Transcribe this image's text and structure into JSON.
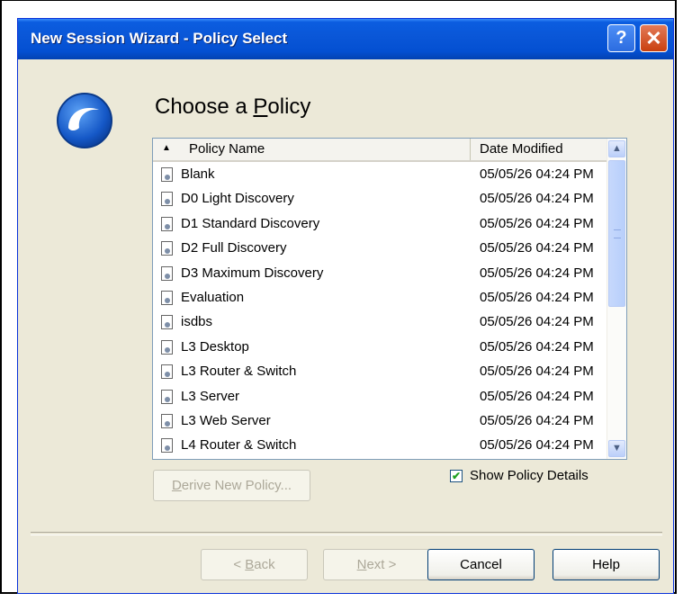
{
  "window": {
    "title": "New Session Wizard - Policy Select",
    "help_glyph": "?",
    "close_glyph": "✕"
  },
  "heading": {
    "prefix": "Choose a ",
    "accel": "P",
    "suffix": "olicy"
  },
  "list": {
    "columns": {
      "name": "Policy Name",
      "date": "Date Modified",
      "sort_glyph": "▲"
    },
    "rows": [
      {
        "name": "Blank",
        "date": "05/05/26 04:24 PM"
      },
      {
        "name": "D0 Light Discovery",
        "date": "05/05/26 04:24 PM"
      },
      {
        "name": "D1 Standard Discovery",
        "date": "05/05/26 04:24 PM"
      },
      {
        "name": "D2 Full Discovery",
        "date": "05/05/26 04:24 PM"
      },
      {
        "name": "D3 Maximum Discovery",
        "date": "05/05/26 04:24 PM"
      },
      {
        "name": "Evaluation",
        "date": "05/05/26 04:24 PM"
      },
      {
        "name": "isdbs",
        "date": "05/05/26 04:24 PM"
      },
      {
        "name": "L3 Desktop",
        "date": "05/05/26 04:24 PM"
      },
      {
        "name": "L3 Router & Switch",
        "date": "05/05/26 04:24 PM"
      },
      {
        "name": "L3 Server",
        "date": "05/05/26 04:24 PM"
      },
      {
        "name": "L3 Web Server",
        "date": "05/05/26 04:24 PM"
      },
      {
        "name": "L4 Router & Switch",
        "date": "05/05/26 04:24 PM"
      }
    ],
    "scroll_up_glyph": "▲",
    "scroll_down_glyph": "▼"
  },
  "derive_button": {
    "accel": "D",
    "rest": "erive New Policy..."
  },
  "show_details": {
    "label": "Show Policy Details",
    "checked": true,
    "check_glyph": "✔"
  },
  "buttons": {
    "back": {
      "prefix": "< ",
      "accel": "B",
      "rest": "ack"
    },
    "next": {
      "accel": "N",
      "rest": "ext >"
    },
    "cancel": "Cancel",
    "help": "Help"
  },
  "colors": {
    "title_bar": "#0A57D8",
    "dialog_bg": "#ECE9D8",
    "list_border": "#7F9DB9"
  },
  "icons": {
    "app_logo": "app-logo-icon",
    "policy_item": "policy-file-icon"
  }
}
